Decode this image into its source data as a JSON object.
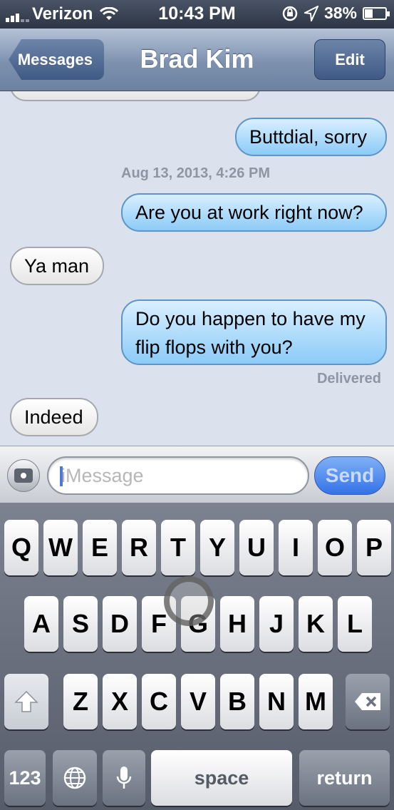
{
  "status_bar": {
    "carrier": "Verizon",
    "time": "10:43 PM",
    "battery": "38%",
    "battery_level": 0.38,
    "icons": [
      "signal-bars-icon",
      "wifi-icon",
      "rotation-lock-icon",
      "location-icon",
      "battery-icon"
    ]
  },
  "nav": {
    "back_label": "Messages",
    "title": "Brad Kim",
    "edit_label": "Edit",
    "bar_color": "#7d91af"
  },
  "conversation": {
    "messages": [
      {
        "text": "Buttdial, sorry",
        "direction": "outgoing"
      },
      {
        "text": "Aug 13, 2013, 4:26 PM",
        "direction": "timestamp"
      },
      {
        "text": "Are you at work right now?",
        "direction": "outgoing"
      },
      {
        "text": "Ya man",
        "direction": "incoming"
      },
      {
        "text": "Do you happen to have my flip flops with you?",
        "line1": "Do you happen to have my",
        "line2": "flip flops with you?",
        "direction": "outgoing"
      },
      {
        "text": "Delivered",
        "direction": "status"
      },
      {
        "text": "Indeed",
        "direction": "incoming"
      }
    ],
    "outgoing_color": "#8ccbf8",
    "incoming_color": "#e6e6e6"
  },
  "input_bar": {
    "placeholder": "iMessage",
    "send_label": "Send",
    "camera_icon": "camera-icon"
  },
  "keyboard": {
    "row1": [
      "Q",
      "W",
      "E",
      "R",
      "T",
      "Y",
      "U",
      "I",
      "O",
      "P"
    ],
    "row2": [
      "A",
      "S",
      "D",
      "F",
      "G",
      "H",
      "J",
      "K",
      "L"
    ],
    "row3": [
      "Z",
      "X",
      "C",
      "V",
      "B",
      "N",
      "M"
    ],
    "numbers_label": "123",
    "space_label": "space",
    "return_label": "return",
    "icons": [
      "shift-icon",
      "backspace-icon",
      "globe-icon",
      "microphone-icon"
    ]
  }
}
